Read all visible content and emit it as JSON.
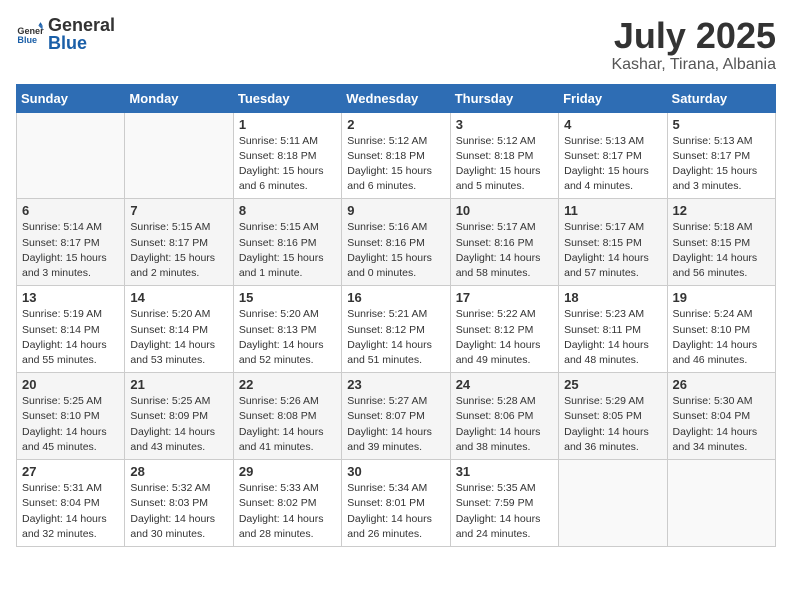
{
  "header": {
    "logo_general": "General",
    "logo_blue": "Blue",
    "title": "July 2025",
    "subtitle": "Kashar, Tirana, Albania"
  },
  "weekdays": [
    "Sunday",
    "Monday",
    "Tuesday",
    "Wednesday",
    "Thursday",
    "Friday",
    "Saturday"
  ],
  "weeks": [
    [
      {
        "day": "",
        "info": ""
      },
      {
        "day": "",
        "info": ""
      },
      {
        "day": "1",
        "info": "Sunrise: 5:11 AM\nSunset: 8:18 PM\nDaylight: 15 hours and 6 minutes."
      },
      {
        "day": "2",
        "info": "Sunrise: 5:12 AM\nSunset: 8:18 PM\nDaylight: 15 hours and 6 minutes."
      },
      {
        "day": "3",
        "info": "Sunrise: 5:12 AM\nSunset: 8:18 PM\nDaylight: 15 hours and 5 minutes."
      },
      {
        "day": "4",
        "info": "Sunrise: 5:13 AM\nSunset: 8:17 PM\nDaylight: 15 hours and 4 minutes."
      },
      {
        "day": "5",
        "info": "Sunrise: 5:13 AM\nSunset: 8:17 PM\nDaylight: 15 hours and 3 minutes."
      }
    ],
    [
      {
        "day": "6",
        "info": "Sunrise: 5:14 AM\nSunset: 8:17 PM\nDaylight: 15 hours and 3 minutes."
      },
      {
        "day": "7",
        "info": "Sunrise: 5:15 AM\nSunset: 8:17 PM\nDaylight: 15 hours and 2 minutes."
      },
      {
        "day": "8",
        "info": "Sunrise: 5:15 AM\nSunset: 8:16 PM\nDaylight: 15 hours and 1 minute."
      },
      {
        "day": "9",
        "info": "Sunrise: 5:16 AM\nSunset: 8:16 PM\nDaylight: 15 hours and 0 minutes."
      },
      {
        "day": "10",
        "info": "Sunrise: 5:17 AM\nSunset: 8:16 PM\nDaylight: 14 hours and 58 minutes."
      },
      {
        "day": "11",
        "info": "Sunrise: 5:17 AM\nSunset: 8:15 PM\nDaylight: 14 hours and 57 minutes."
      },
      {
        "day": "12",
        "info": "Sunrise: 5:18 AM\nSunset: 8:15 PM\nDaylight: 14 hours and 56 minutes."
      }
    ],
    [
      {
        "day": "13",
        "info": "Sunrise: 5:19 AM\nSunset: 8:14 PM\nDaylight: 14 hours and 55 minutes."
      },
      {
        "day": "14",
        "info": "Sunrise: 5:20 AM\nSunset: 8:14 PM\nDaylight: 14 hours and 53 minutes."
      },
      {
        "day": "15",
        "info": "Sunrise: 5:20 AM\nSunset: 8:13 PM\nDaylight: 14 hours and 52 minutes."
      },
      {
        "day": "16",
        "info": "Sunrise: 5:21 AM\nSunset: 8:12 PM\nDaylight: 14 hours and 51 minutes."
      },
      {
        "day": "17",
        "info": "Sunrise: 5:22 AM\nSunset: 8:12 PM\nDaylight: 14 hours and 49 minutes."
      },
      {
        "day": "18",
        "info": "Sunrise: 5:23 AM\nSunset: 8:11 PM\nDaylight: 14 hours and 48 minutes."
      },
      {
        "day": "19",
        "info": "Sunrise: 5:24 AM\nSunset: 8:10 PM\nDaylight: 14 hours and 46 minutes."
      }
    ],
    [
      {
        "day": "20",
        "info": "Sunrise: 5:25 AM\nSunset: 8:10 PM\nDaylight: 14 hours and 45 minutes."
      },
      {
        "day": "21",
        "info": "Sunrise: 5:25 AM\nSunset: 8:09 PM\nDaylight: 14 hours and 43 minutes."
      },
      {
        "day": "22",
        "info": "Sunrise: 5:26 AM\nSunset: 8:08 PM\nDaylight: 14 hours and 41 minutes."
      },
      {
        "day": "23",
        "info": "Sunrise: 5:27 AM\nSunset: 8:07 PM\nDaylight: 14 hours and 39 minutes."
      },
      {
        "day": "24",
        "info": "Sunrise: 5:28 AM\nSunset: 8:06 PM\nDaylight: 14 hours and 38 minutes."
      },
      {
        "day": "25",
        "info": "Sunrise: 5:29 AM\nSunset: 8:05 PM\nDaylight: 14 hours and 36 minutes."
      },
      {
        "day": "26",
        "info": "Sunrise: 5:30 AM\nSunset: 8:04 PM\nDaylight: 14 hours and 34 minutes."
      }
    ],
    [
      {
        "day": "27",
        "info": "Sunrise: 5:31 AM\nSunset: 8:04 PM\nDaylight: 14 hours and 32 minutes."
      },
      {
        "day": "28",
        "info": "Sunrise: 5:32 AM\nSunset: 8:03 PM\nDaylight: 14 hours and 30 minutes."
      },
      {
        "day": "29",
        "info": "Sunrise: 5:33 AM\nSunset: 8:02 PM\nDaylight: 14 hours and 28 minutes."
      },
      {
        "day": "30",
        "info": "Sunrise: 5:34 AM\nSunset: 8:01 PM\nDaylight: 14 hours and 26 minutes."
      },
      {
        "day": "31",
        "info": "Sunrise: 5:35 AM\nSunset: 7:59 PM\nDaylight: 14 hours and 24 minutes."
      },
      {
        "day": "",
        "info": ""
      },
      {
        "day": "",
        "info": ""
      }
    ]
  ]
}
